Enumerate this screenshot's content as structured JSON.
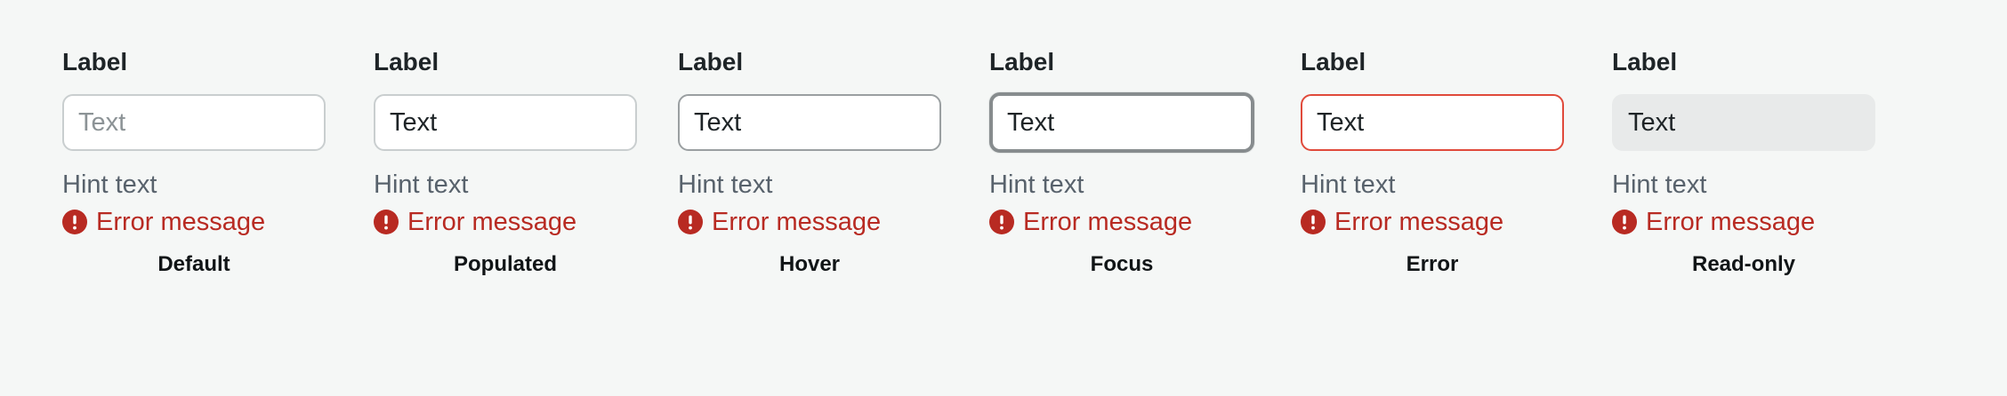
{
  "fields": [
    {
      "state": "Default",
      "label": "Label",
      "value": "",
      "placeholder": "Text",
      "hint": "Hint text",
      "error": "Error message"
    },
    {
      "state": "Populated",
      "label": "Label",
      "value": "Text",
      "placeholder": "",
      "hint": "Hint text",
      "error": "Error message"
    },
    {
      "state": "Hover",
      "label": "Label",
      "value": "Text",
      "placeholder": "",
      "hint": "Hint text",
      "error": "Error message"
    },
    {
      "state": "Focus",
      "label": "Label",
      "value": "Text",
      "placeholder": "",
      "hint": "Hint text",
      "error": "Error message"
    },
    {
      "state": "Error",
      "label": "Label",
      "value": "Text",
      "placeholder": "",
      "hint": "Hint text",
      "error": "Error message"
    },
    {
      "state": "Read-only",
      "label": "Label",
      "value": "Text",
      "placeholder": "",
      "hint": "Hint text",
      "error": "Error message"
    }
  ],
  "icons": {
    "error": "exclamation-circle-icon"
  },
  "colors": {
    "background": "#f5f7f6",
    "label": "#1e2427",
    "hint": "#58626c",
    "error_text": "#b82a22",
    "error_border": "#e04a3b",
    "default_border": "#c9cecf",
    "hover_border": "#9a9fa1",
    "focus_border": "#878c8e",
    "readonly_fill": "#e8eaea"
  }
}
